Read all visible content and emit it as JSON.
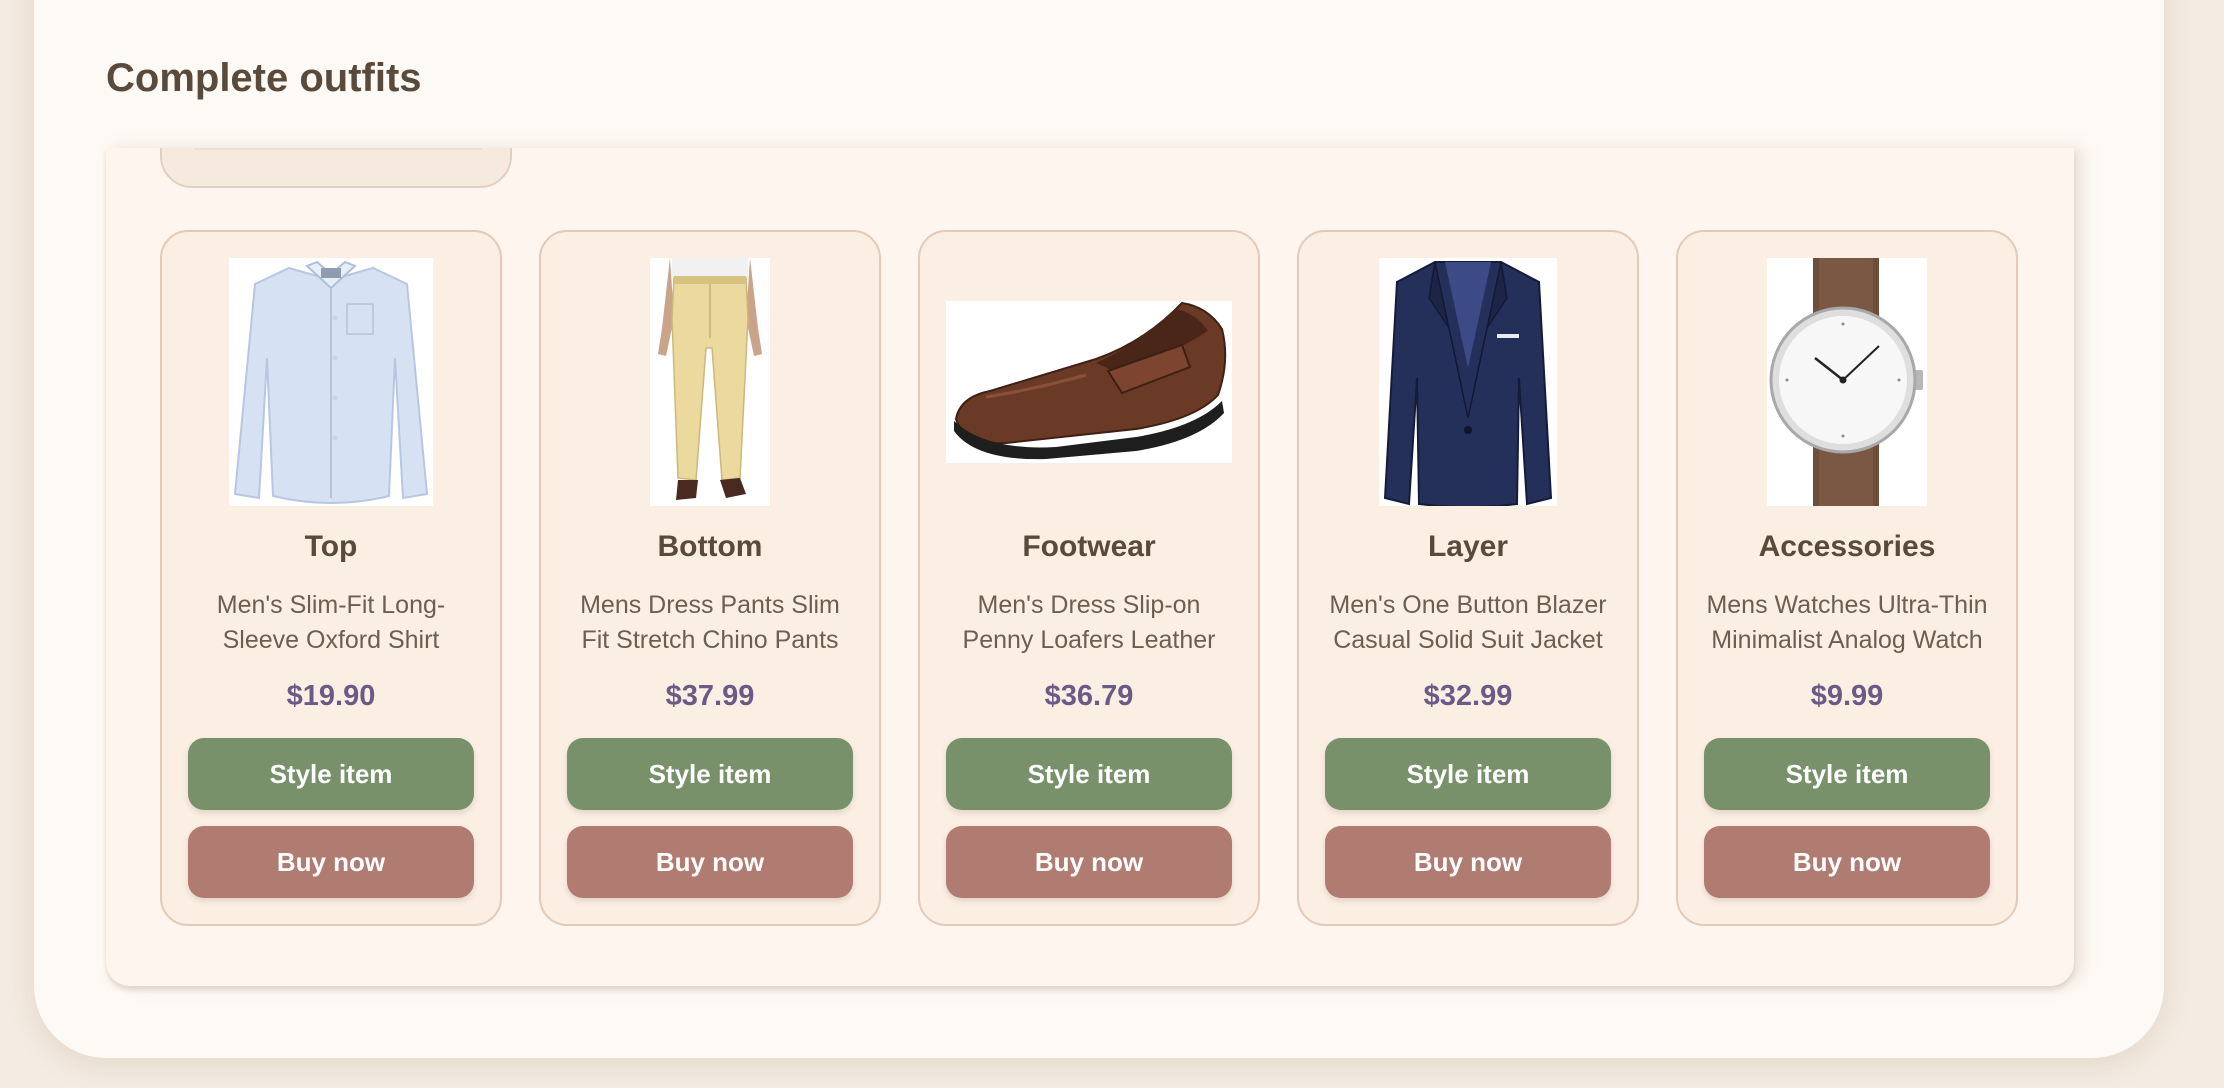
{
  "section": {
    "title": "Complete outfits"
  },
  "colors": {
    "style_button": "#78916b",
    "buy_button": "#b07b70",
    "price": "#6c5a86",
    "card_background": "#fbeee3"
  },
  "items": [
    {
      "category": "Top",
      "name": "Men's Slim-Fit Long-Sleeve Oxford Shirt",
      "price": "$19.90",
      "image": "shirt-image",
      "style_label": "Style item",
      "buy_label": "Buy now"
    },
    {
      "category": "Bottom",
      "name": "Mens Dress Pants Slim Fit Stretch Chino Pants",
      "price": "$37.99",
      "image": "pants-image",
      "style_label": "Style item",
      "buy_label": "Buy now"
    },
    {
      "category": "Footwear",
      "name": "Men's Dress Slip-on Penny Loafers Leather",
      "price": "$36.79",
      "image": "loafer-image",
      "style_label": "Style item",
      "buy_label": "Buy now"
    },
    {
      "category": "Layer",
      "name": "Men's One Button Blazer Casual Solid Suit Jacket",
      "price": "$32.99",
      "image": "blazer-image",
      "style_label": "Style item",
      "buy_label": "Buy now"
    },
    {
      "category": "Accessories",
      "name": "Mens Watches Ultra-Thin Minimalist Analog Watch",
      "price": "$9.99",
      "image": "watch-image",
      "style_label": "Style item",
      "buy_label": "Buy now"
    }
  ]
}
